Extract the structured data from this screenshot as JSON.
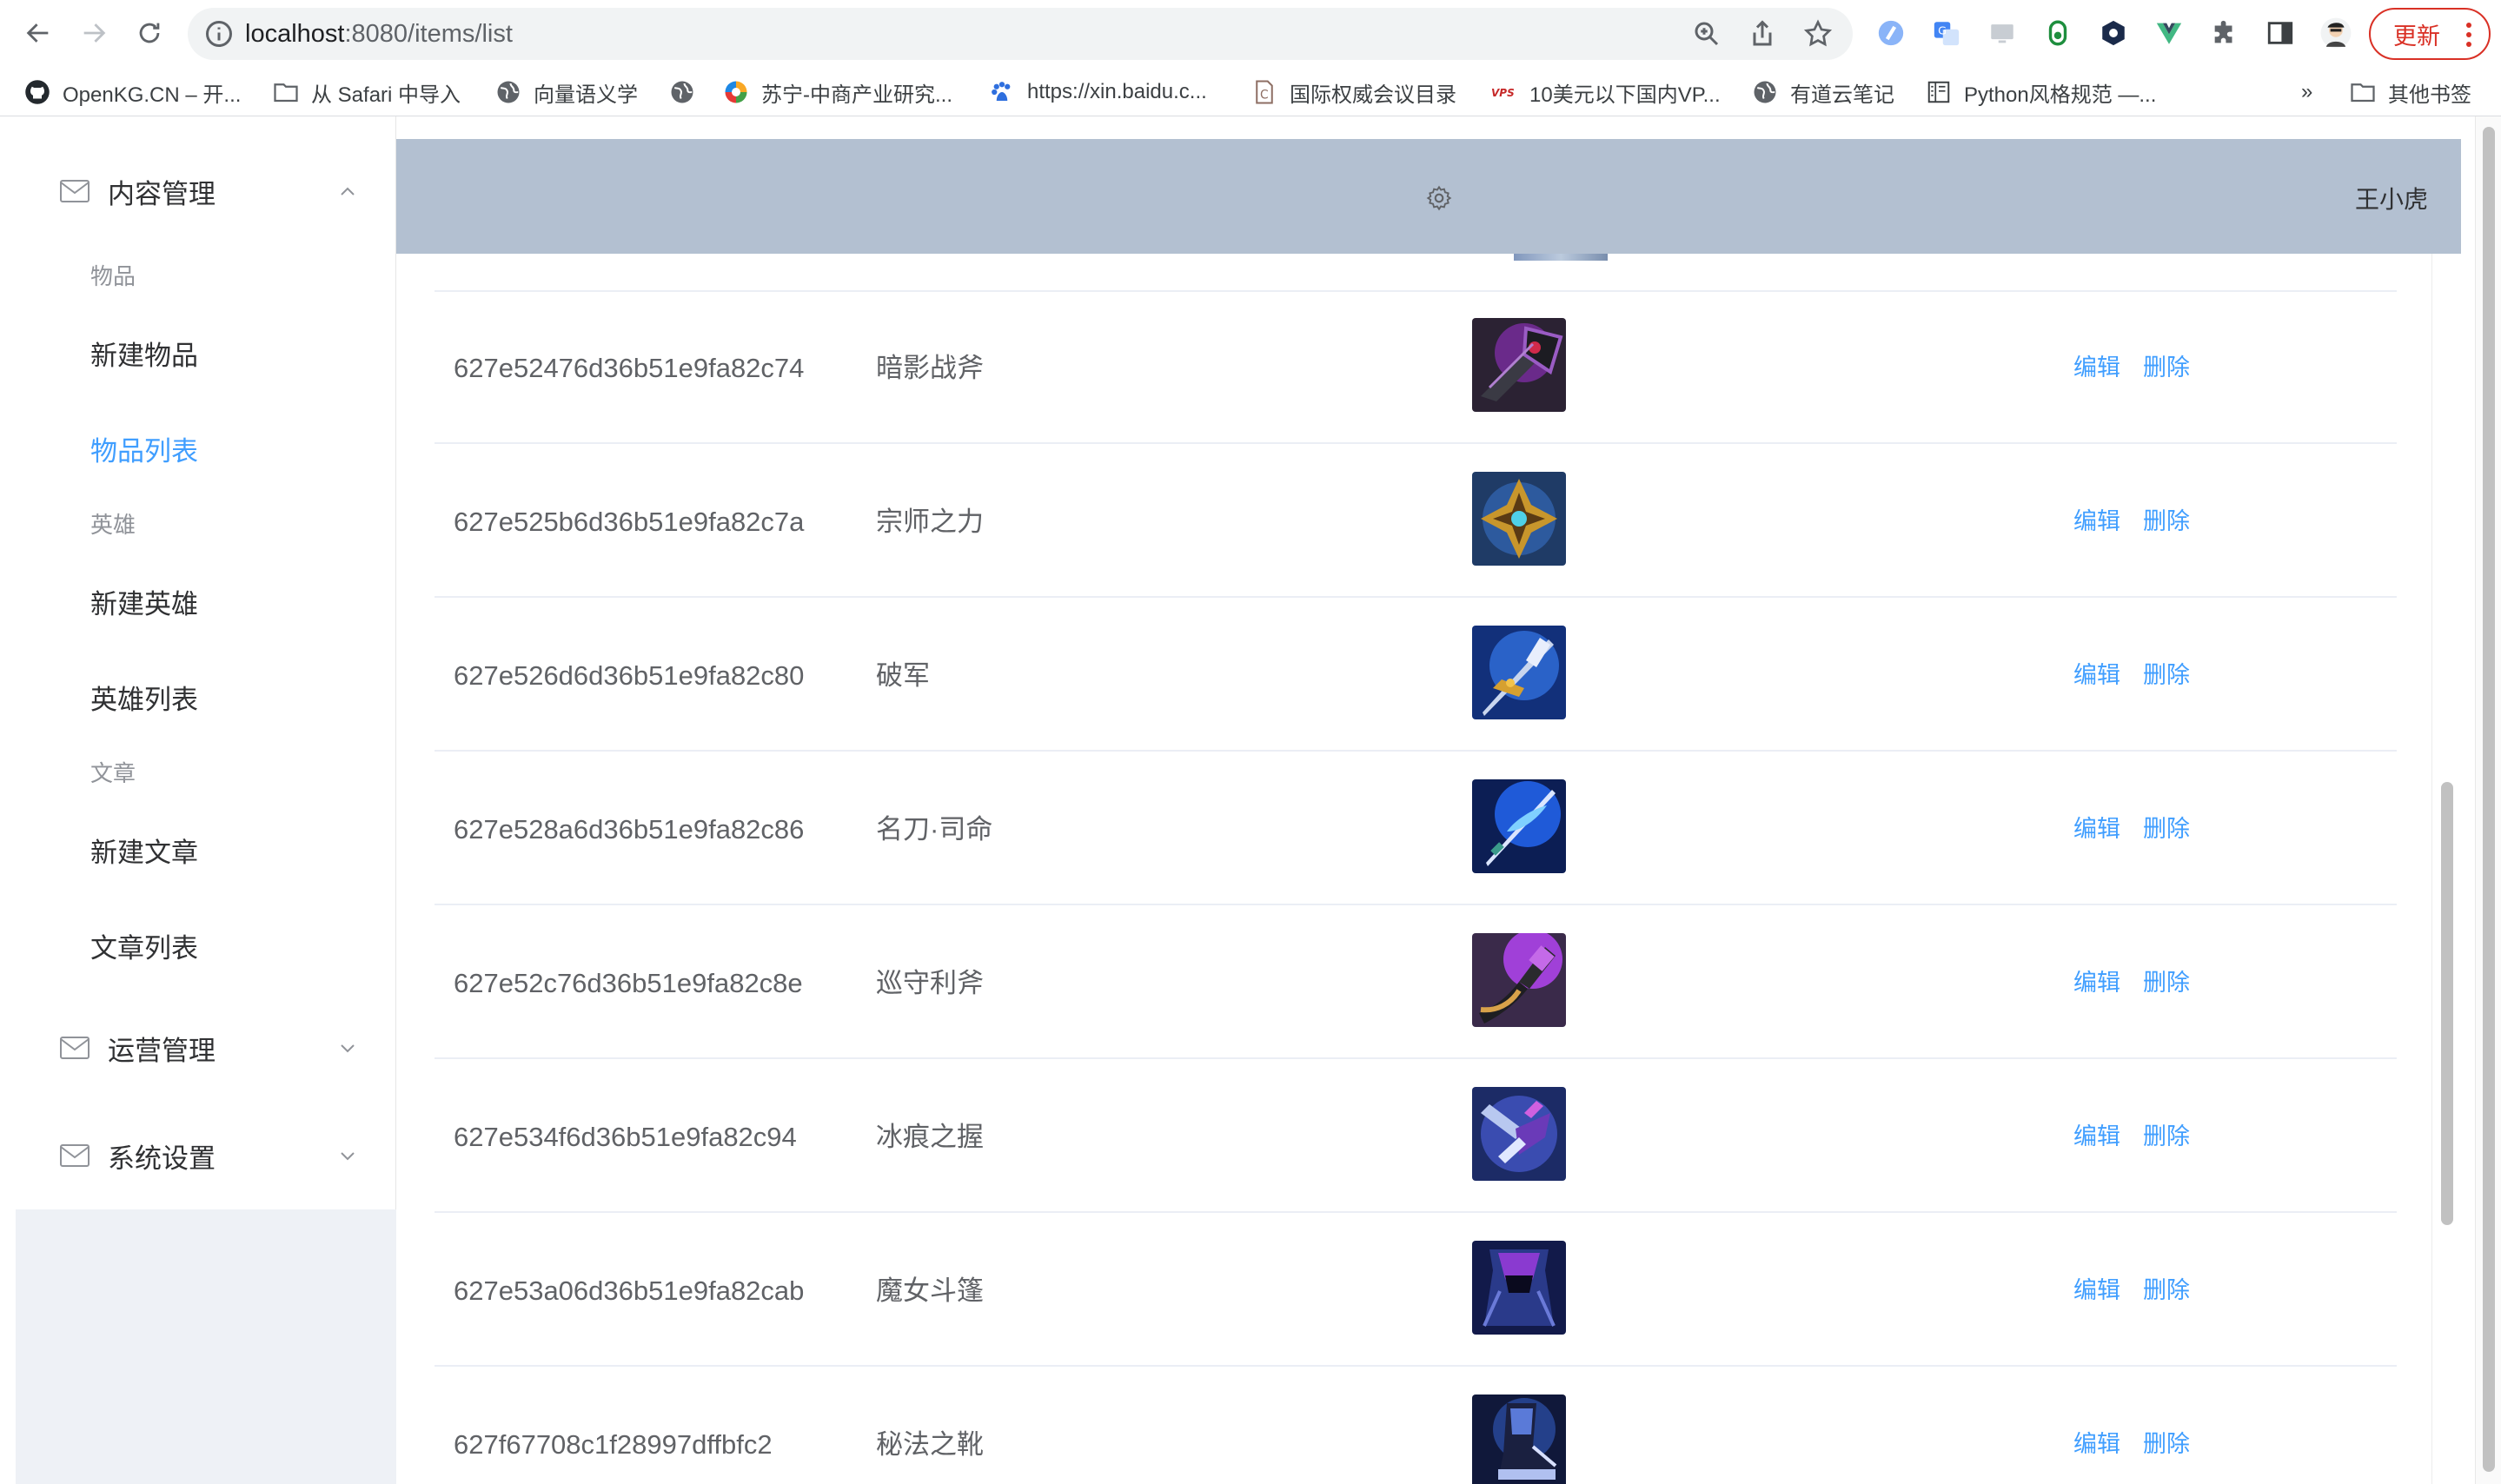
{
  "browser": {
    "url_host": "localhost",
    "url_rest": ":8080/items/list",
    "update_label": "更新",
    "bookmarks": [
      {
        "label": "OpenKG.CN – 开...",
        "icon": "github-icon"
      },
      {
        "label": "从 Safari 中导入",
        "icon": "folder-icon"
      },
      {
        "label": "向量语义学",
        "icon": "globe-icon"
      },
      {
        "label": "",
        "icon": "globe-icon"
      },
      {
        "label": "苏宁-中商产业研究...",
        "icon": "suning-icon"
      },
      {
        "label": "https://xin.baidu.c...",
        "icon": "baidu-icon"
      },
      {
        "label": "国际权威会议目录",
        "icon": "c-doc-icon"
      },
      {
        "label": "10美元以下国内VP...",
        "icon": "vps-icon"
      },
      {
        "label": "有道云笔记",
        "icon": "globe-icon"
      },
      {
        "label": "Python风格规范 —...",
        "icon": "book-icon"
      }
    ],
    "more": "»",
    "other_bookmarks": "其他书签"
  },
  "sidebar": {
    "menus": [
      {
        "title": "内容管理",
        "expanded": true
      },
      {
        "title": "运营管理",
        "expanded": false
      },
      {
        "title": "系统设置",
        "expanded": false
      }
    ],
    "groups": [
      {
        "title": "物品",
        "items": [
          "新建物品",
          "物品列表"
        ]
      },
      {
        "title": "英雄",
        "items": [
          "新建英雄",
          "英雄列表"
        ]
      },
      {
        "title": "文章",
        "items": [
          "新建文章",
          "文章列表"
        ]
      }
    ],
    "active_item": "物品列表"
  },
  "header": {
    "user_name": "王小虎"
  },
  "table": {
    "rows": [
      {
        "id": "627e52476d36b51e9fa82c74",
        "name": "暗影战斧",
        "icon": "shadow-axe-icon",
        "edit": "编辑",
        "delete": "删除"
      },
      {
        "id": "627e525b6d36b51e9fa82c7a",
        "name": "宗师之力",
        "icon": "master-power-icon",
        "edit": "编辑",
        "delete": "删除"
      },
      {
        "id": "627e526d6d36b51e9fa82c80",
        "name": "破军",
        "icon": "po-jun-icon",
        "edit": "编辑",
        "delete": "删除"
      },
      {
        "id": "627e528a6d36b51e9fa82c86",
        "name": "名刀·司命",
        "icon": "famed-blade-icon",
        "edit": "编辑",
        "delete": "删除"
      },
      {
        "id": "627e52c76d36b51e9fa82c8e",
        "name": "巡守利斧",
        "icon": "patrol-axe-icon",
        "edit": "编辑",
        "delete": "删除"
      },
      {
        "id": "627e534f6d36b51e9fa82c94",
        "name": "冰痕之握",
        "icon": "frost-grip-icon",
        "edit": "编辑",
        "delete": "删除"
      },
      {
        "id": "627e53a06d36b51e9fa82cab",
        "name": "魔女斗篷",
        "icon": "witch-cloak-icon",
        "edit": "编辑",
        "delete": "删除"
      },
      {
        "id": "627f67708c1f28997dffbfc2",
        "name": "秘法之靴",
        "icon": "arcane-boots-icon",
        "edit": "编辑",
        "delete": "删除"
      }
    ]
  }
}
